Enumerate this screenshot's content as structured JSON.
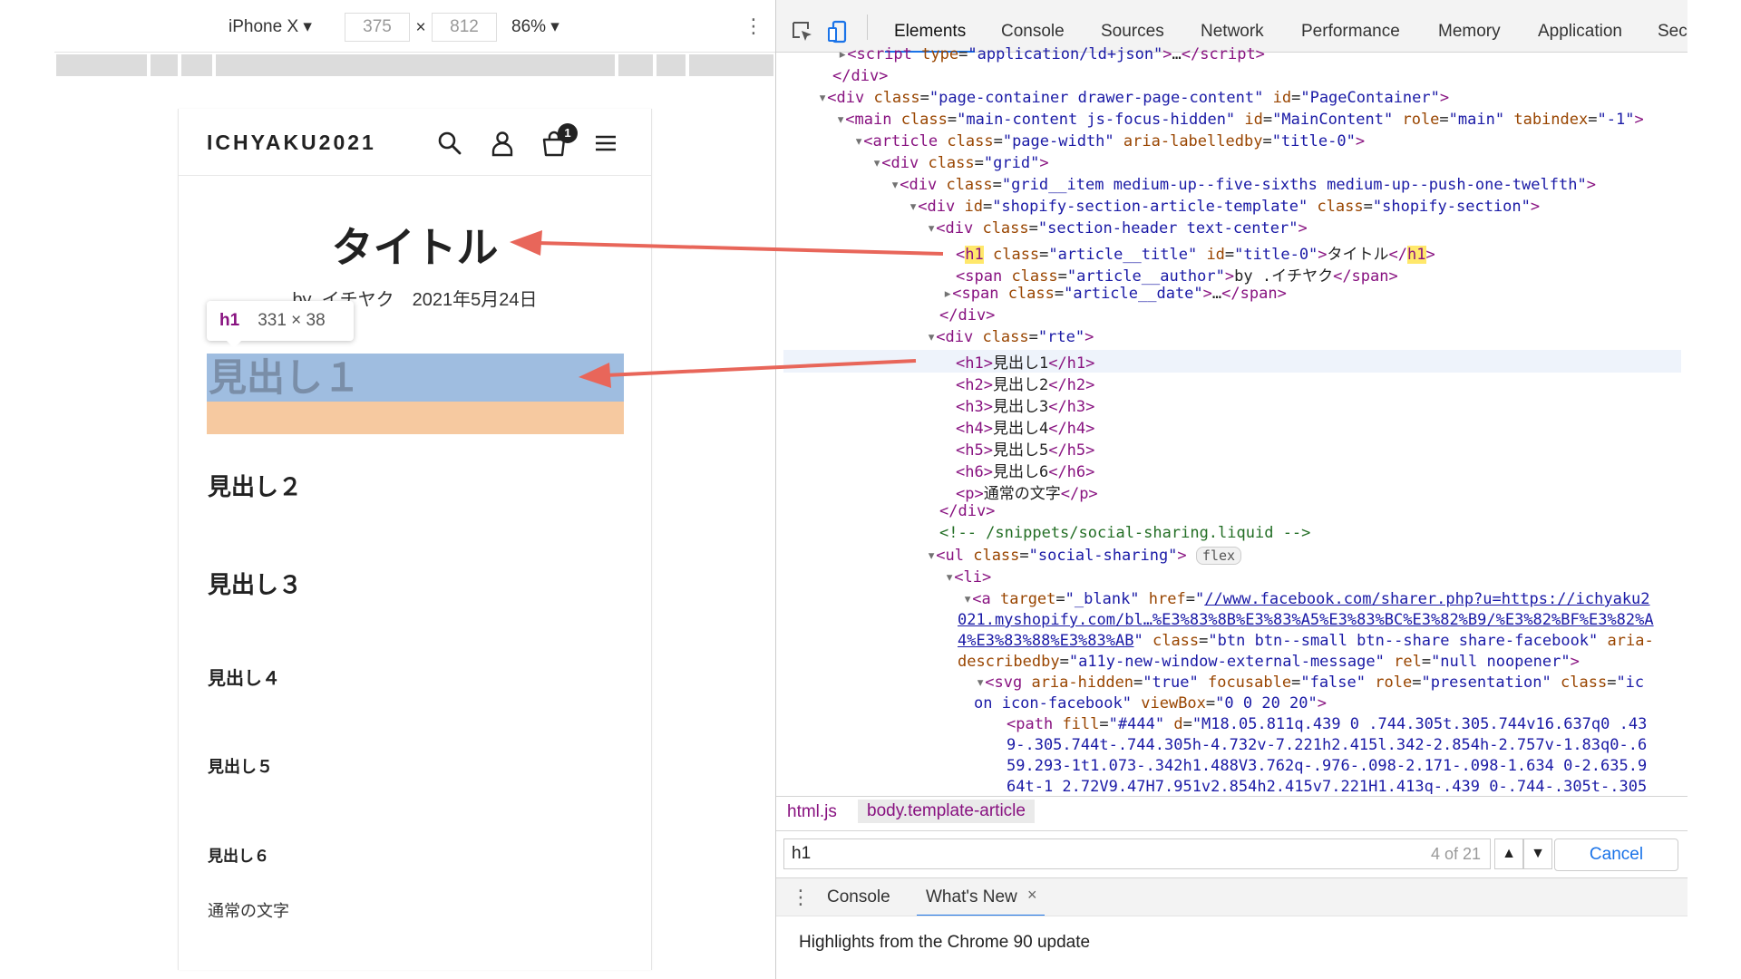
{
  "device_toolbar": {
    "device": "iPhone X ▾",
    "width": "375",
    "times": "×",
    "height": "812",
    "zoom": "86% ▾",
    "more": "⋮"
  },
  "phone": {
    "logo": "ICHYAKU2021",
    "cart_count": "1",
    "article_title": "タイトル",
    "byline": "by .イチヤク　2021年5月24日",
    "tooltip_tag": "h1",
    "tooltip_dims": "331 × 38",
    "headings": {
      "h1": "見出し１",
      "h2": "見出し２",
      "h3": "見出し３",
      "h4": "見出し４",
      "h5": "見出し５",
      "h6": "見出し６",
      "p": "通常の文字"
    }
  },
  "devtools": {
    "tabs": [
      "Elements",
      "Console",
      "Sources",
      "Network",
      "Performance",
      "Memory",
      "Application",
      "Sec"
    ],
    "breadcrumbs": [
      "html.js",
      "body.template-article"
    ],
    "search": {
      "query": "h1",
      "count": "4 of 21",
      "up": "▲",
      "down": "▼",
      "cancel": "Cancel"
    },
    "drawer": {
      "more": "⋮",
      "tabs": [
        "Console",
        "What's New"
      ],
      "close": "×",
      "message": "Highlights from the Chrome 90 update"
    }
  },
  "colors": {
    "accent": "#1a73e8",
    "arrow": "#e8665a",
    "content_highlight": "#9fbde0",
    "margin_highlight": "#f6c9a0",
    "search_highlight": "#ffe86b"
  }
}
